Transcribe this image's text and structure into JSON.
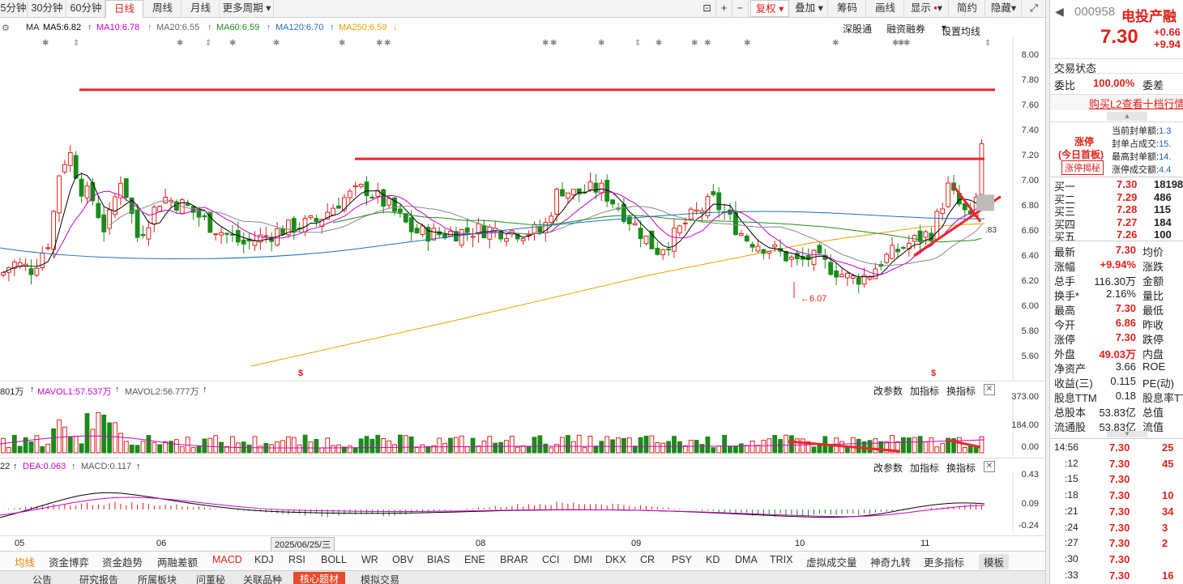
{
  "toolbar": {
    "periods": [
      "5分钟",
      "30分钟",
      "60分钟",
      "日线",
      "周线",
      "月线",
      "更多周期"
    ],
    "active_period": "日线",
    "right_tools": [
      "复权",
      "叠加",
      "筹码",
      "画线",
      "显示",
      "简约",
      "隐藏"
    ]
  },
  "ma_legend": {
    "ma": "MA",
    "ma5": "MA5:6.82",
    "ma10": "MA10:6.78",
    "ma20": "MA20:6.55",
    "ma60": "MA60:6.59",
    "ma120": "MA120:6.70",
    "ma250": "MA250:6.59",
    "links": [
      "深股通",
      "融资融券",
      "设置均线"
    ],
    "colors": {
      "ma5": "#000000",
      "ma10": "#cc00cc",
      "ma20": "#888888",
      "ma60": "#1f8f1f",
      "ma120": "#1f6fbf",
      "ma250": "#e6a000"
    }
  },
  "price_axis": [
    "8.00",
    "7.80",
    "7.60",
    "7.40",
    "7.20",
    "7.00",
    "6.80",
    "6.60",
    "6.40",
    "6.20",
    "6.00",
    "5.80",
    "5.60"
  ],
  "annotations": {
    "low_label": "6.07",
    "current_tag": "6.83",
    "dividend_mark": "$",
    "high_line_1": "7.73",
    "high_line_2": "7.18"
  },
  "volume_panel": {
    "label_prefix": "801万",
    "mavol1": "MAVOL1:57.537万",
    "mavol2": "MAVOL2:56.777万",
    "axis": [
      "373.00",
      "184.00",
      "0.00"
    ],
    "links": [
      "改参数",
      "加指标",
      "换指标"
    ]
  },
  "macd_panel": {
    "label_prefix": "22",
    "dea": "DEA:0.063",
    "macd": "MACD:0.117",
    "axis": [
      "0.43",
      "0.09",
      "-0.24"
    ],
    "links": [
      "改参数",
      "加指标",
      "换指标"
    ]
  },
  "x_axis": {
    "labels": [
      "05",
      "06",
      "08",
      "09",
      "10",
      "11"
    ],
    "cursor_date": "2025/06/25/三"
  },
  "indicators": [
    "均线",
    "资金博弈",
    "资金趋势",
    "两融差额",
    "MACD",
    "KDJ",
    "RSI",
    "BOLL",
    "WR",
    "OBV",
    "BIAS",
    "ENE",
    "BRAR",
    "CCI",
    "DMI",
    "DKX",
    "CR",
    "PSY",
    "KD",
    "DMA",
    "TRIX",
    "虚拟成交量",
    "神奇九转",
    "更多指标",
    "模板"
  ],
  "bottom_tabs": [
    "公告",
    "研究报告",
    "所属板块",
    "问董秘",
    "关联品种",
    "核心题材",
    "模拟交易"
  ],
  "active_bottom_tab": "核心题材",
  "quote": {
    "code": "000958",
    "name": "电投产融",
    "price": "7.30",
    "change": "+0.66",
    "change_pct": "+9.94",
    "trade_status": "交易状态",
    "weibi_label": "委比",
    "weibi": "100.00%",
    "weicha_label": "委差",
    "l2_link": "购买L2查看十档行情",
    "limit_tag": "涨停",
    "limit_sub": "(今日首板)",
    "limit_btn": "涨停揭秘",
    "limit_stats": [
      {
        "label": "当前封单额:",
        "value": "1.3"
      },
      {
        "label": "封单占成交:",
        "value": "15."
      },
      {
        "label": "最高封单额:",
        "value": "14."
      },
      {
        "label": "涨停成交额:",
        "value": "4.4"
      }
    ],
    "order_book": [
      {
        "label": "买一",
        "price": "7.30",
        "vol": "18198"
      },
      {
        "label": "买二",
        "price": "7.29",
        "vol": "486"
      },
      {
        "label": "买三",
        "price": "7.28",
        "vol": "115"
      },
      {
        "label": "买四",
        "price": "7.27",
        "vol": "184"
      },
      {
        "label": "买五",
        "price": "7.26",
        "vol": "100"
      }
    ],
    "stats": [
      {
        "l": "最新",
        "v": "7.30",
        "l2": "均价",
        "c": "red"
      },
      {
        "l": "涨幅",
        "v": "+9.94%",
        "l2": "涨跌",
        "c": "red"
      },
      {
        "l": "总手",
        "v": "116.30万",
        "l2": "金额",
        "c": "dark"
      },
      {
        "l": "换手*",
        "v": "2.16%",
        "l2": "量比",
        "c": "dark"
      },
      {
        "l": "最高",
        "v": "7.30",
        "l2": "最低",
        "c": "red"
      },
      {
        "l": "今开",
        "v": "6.86",
        "l2": "昨收",
        "c": "red"
      },
      {
        "l": "涨停",
        "v": "7.30",
        "l2": "跌停",
        "c": "red"
      },
      {
        "l": "外盘",
        "v": "49.03万",
        "l2": "内盘",
        "c": "red"
      },
      {
        "l": "净资产",
        "v": "3.66",
        "l2": "ROE",
        "c": "dark"
      },
      {
        "l": "收益(三)",
        "v": "0.115",
        "l2": "PE(动)",
        "c": "dark"
      },
      {
        "l": "股息TTM",
        "v": "0.18",
        "l2": "股息率TT",
        "c": "dark"
      },
      {
        "l": "总股本",
        "v": "53.83亿",
        "l2": "总值",
        "c": "dark"
      },
      {
        "l": "流通股",
        "v": "53.83亿",
        "l2": "流值",
        "c": "dark"
      }
    ],
    "ticks": [
      {
        "t": "14:56",
        "p": "7.30",
        "v": "25"
      },
      {
        "t": ":12",
        "p": "7.30",
        "v": "45"
      },
      {
        "t": ":15",
        "p": "7.30",
        "v": ""
      },
      {
        "t": ":18",
        "p": "7.30",
        "v": "10"
      },
      {
        "t": ":21",
        "p": "7.30",
        "v": "34"
      },
      {
        "t": ":24",
        "p": "7.30",
        "v": "3"
      },
      {
        "t": ":27",
        "p": "7.30",
        "v": "2"
      },
      {
        "t": ":30",
        "p": "7.30",
        "v": ""
      },
      {
        "t": ":33",
        "p": "7.30",
        "v": "16"
      }
    ]
  }
}
